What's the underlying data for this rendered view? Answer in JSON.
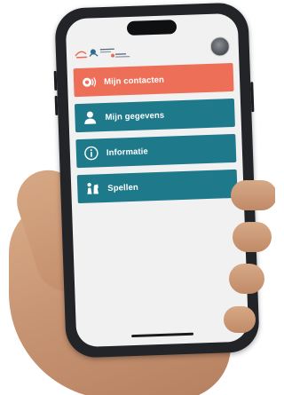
{
  "app": {
    "brand_colors": {
      "accent": "#ee6f57",
      "primary": "#1e7a8a",
      "background": "#f1f1f1"
    }
  },
  "header": {
    "logo_icon": "app-logo-icon",
    "avatar_icon": "user-avatar-icon"
  },
  "menu": {
    "items": [
      {
        "label": "Mijn contacten",
        "icon": "contacts-signal-icon",
        "color": "#ee6f57"
      },
      {
        "label": "Mijn gegevens",
        "icon": "person-icon",
        "color": "#1e7a8a"
      },
      {
        "label": "Informatie",
        "icon": "info-icon",
        "color": "#1e7a8a"
      },
      {
        "label": "Spellen",
        "icon": "game-pieces-icon",
        "color": "#1e7a8a"
      }
    ]
  }
}
